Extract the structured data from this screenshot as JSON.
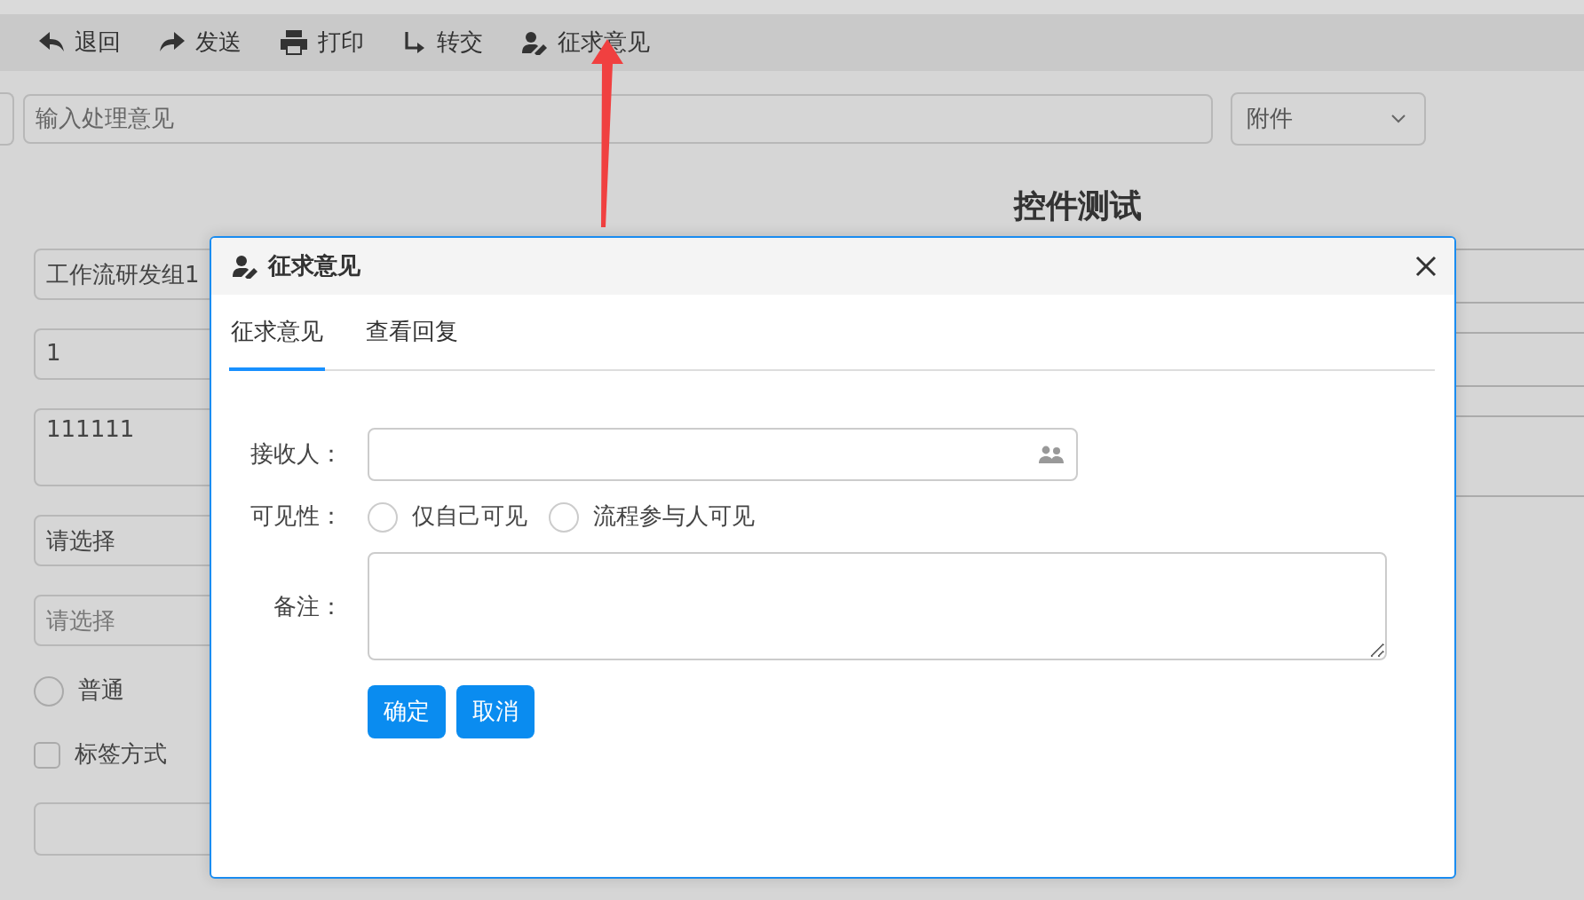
{
  "toolbar": [
    {
      "label": "退回"
    },
    {
      "label": "发送"
    },
    {
      "label": "打印"
    },
    {
      "label": "转交"
    },
    {
      "label": "征求意见"
    }
  ],
  "opinion": {
    "placeholder": "输入处理意见"
  },
  "attachment": {
    "value": "附件"
  },
  "title": "控件测试",
  "form": {
    "fields": [
      {
        "kind": "input",
        "value": "工作流研发组1"
      },
      {
        "kind": "input",
        "value": "1"
      },
      {
        "kind": "textarea",
        "value": "111111"
      },
      {
        "kind": "select",
        "value": "请选择"
      },
      {
        "kind": "select",
        "placeholder": "请选择"
      }
    ],
    "radios": [
      {
        "label": "普通",
        "selected": false
      }
    ],
    "checkboxes": [
      {
        "label": "标签方式",
        "checked": false
      }
    ]
  },
  "dialog": {
    "title": "征求意见",
    "tabs": [
      {
        "label": "征求意见",
        "selected": true
      },
      {
        "label": "查看回复",
        "selected": false
      }
    ],
    "receiver": {
      "label": "接收人："
    },
    "visibility": {
      "label": "可见性：",
      "options": [
        {
          "label": "仅自己可见",
          "selected": false
        },
        {
          "label": "流程参与人可见",
          "selected": false
        }
      ]
    },
    "remark": {
      "label": "备注："
    },
    "buttons": [
      {
        "label": "确定"
      },
      {
        "label": "取消"
      }
    ]
  }
}
